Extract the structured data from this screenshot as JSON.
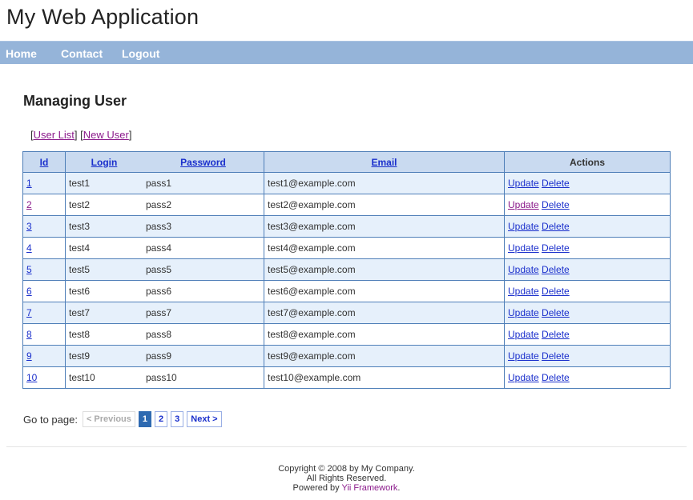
{
  "header": {
    "title": "My Web Application"
  },
  "mainmenu": {
    "home": "Home",
    "contact": "Contact",
    "logout": "Logout"
  },
  "heading": "Managing User",
  "actions": {
    "user_list": "User List",
    "new_user": "New User"
  },
  "table": {
    "headers": {
      "id": "Id",
      "login": "Login",
      "password": "Password",
      "email": "Email",
      "actions": "Actions"
    },
    "update_label": "Update",
    "delete_label": "Delete",
    "rows": [
      {
        "id": "1",
        "login": "test1",
        "password": "pass1",
        "email": "test1@example.com"
      },
      {
        "id": "2",
        "login": "test2",
        "password": "pass2",
        "email": "test2@example.com"
      },
      {
        "id": "3",
        "login": "test3",
        "password": "pass3",
        "email": "test3@example.com"
      },
      {
        "id": "4",
        "login": "test4",
        "password": "pass4",
        "email": "test4@example.com"
      },
      {
        "id": "5",
        "login": "test5",
        "password": "pass5",
        "email": "test5@example.com"
      },
      {
        "id": "6",
        "login": "test6",
        "password": "pass6",
        "email": "test6@example.com"
      },
      {
        "id": "7",
        "login": "test7",
        "password": "pass7",
        "email": "test7@example.com"
      },
      {
        "id": "8",
        "login": "test8",
        "password": "pass8",
        "email": "test8@example.com"
      },
      {
        "id": "9",
        "login": "test9",
        "password": "pass9",
        "email": "test9@example.com"
      },
      {
        "id": "10",
        "login": "test10",
        "password": "pass10",
        "email": "test10@example.com"
      }
    ]
  },
  "pager": {
    "label": "Go to page:",
    "previous": "< Previous",
    "pages": [
      "1",
      "2",
      "3"
    ],
    "current_page": "1",
    "next": "Next >"
  },
  "footer": {
    "copyright": "Copyright © 2008 by My Company.",
    "rights": "All Rights Reserved.",
    "powered_prefix": "Powered by ",
    "powered_link": "Yii Framework",
    "powered_suffix": "."
  },
  "colors": {
    "menu_bar": "#95b4d9",
    "table_border": "#4f7fb8",
    "header_bg": "#c9daf0",
    "row_alt": "#e6f0fb",
    "link": "#1a2fcc",
    "visited_link": "#8b1a8b",
    "pager_selected": "#2e6ab1"
  }
}
